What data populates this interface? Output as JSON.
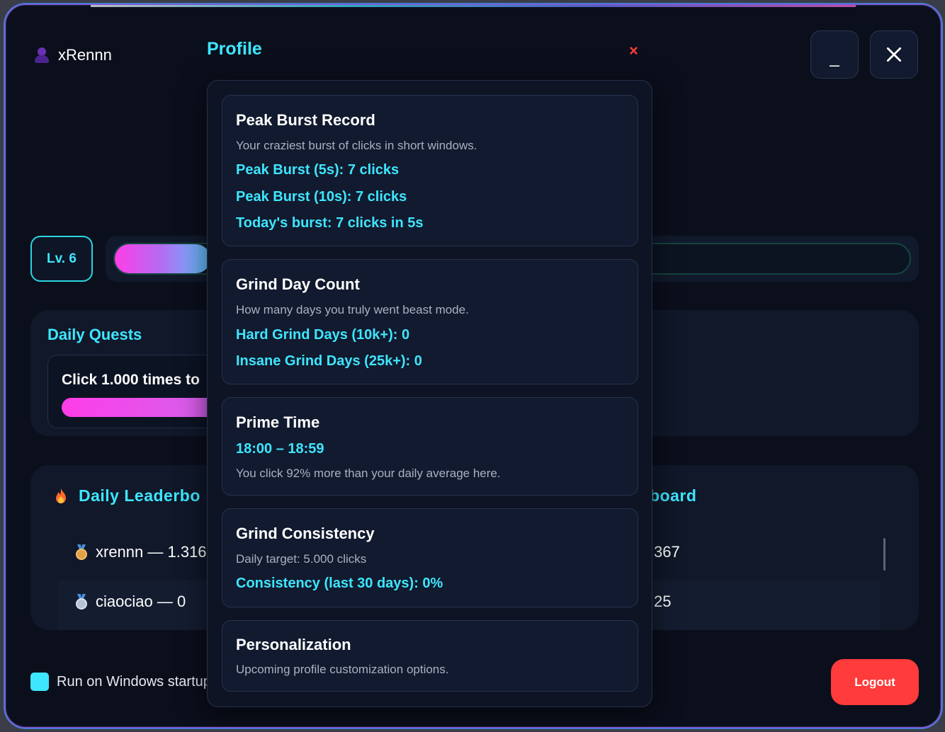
{
  "user": {
    "name": "xRennn",
    "icon": "user-icon"
  },
  "window_controls": {
    "minimize_label": "_",
    "close_icon": "close-icon"
  },
  "level": {
    "label": "Lv. 6",
    "xp_progress": 0.12
  },
  "quests": {
    "title": "Daily Quests",
    "items": [
      {
        "text": "Click 1.000 times to",
        "progress": 1.0
      }
    ]
  },
  "leaderboard": {
    "daily_title": "Daily Leaderbo",
    "other_title_fragment": "board",
    "rows": [
      {
        "medal": "bronze",
        "text": "xrennn — 1.316",
        "right_fragment": "367"
      },
      {
        "medal": "silver",
        "text": "ciaociao — 0",
        "right_fragment": "25"
      }
    ]
  },
  "startup": {
    "label": "Run on Windows startup",
    "checked": true
  },
  "logout_label": "Logout",
  "profile_modal": {
    "title": "Profile",
    "close_label": "×",
    "cards": [
      {
        "title": "Peak Burst Record",
        "description": "Your craziest burst of clicks in short windows.",
        "stats": [
          "Peak Burst (5s): 7 clicks",
          "Peak Burst (10s): 7 clicks",
          "Today's burst: 7 clicks in 5s"
        ]
      },
      {
        "title": "Grind Day Count",
        "description": "How many days you truly went beast mode.",
        "stats": [
          "Hard Grind Days (10k+): 0",
          "Insane Grind Days (25k+): 0"
        ]
      },
      {
        "title": "Prime Time",
        "stats": [
          "18:00 – 18:59"
        ],
        "description": "You click 92% more than your daily average here."
      },
      {
        "title": "Grind Consistency",
        "description": "Daily target: 5.000 clicks",
        "stats": [
          "Consistency (last 30 days): 0%"
        ]
      },
      {
        "title": "Personalization",
        "description": "Upcoming profile customization options."
      }
    ]
  },
  "colors": {
    "accent": "#3ee6ff",
    "danger": "#ff3b3b",
    "background": "#0b0f1c",
    "panel": "#101829"
  }
}
